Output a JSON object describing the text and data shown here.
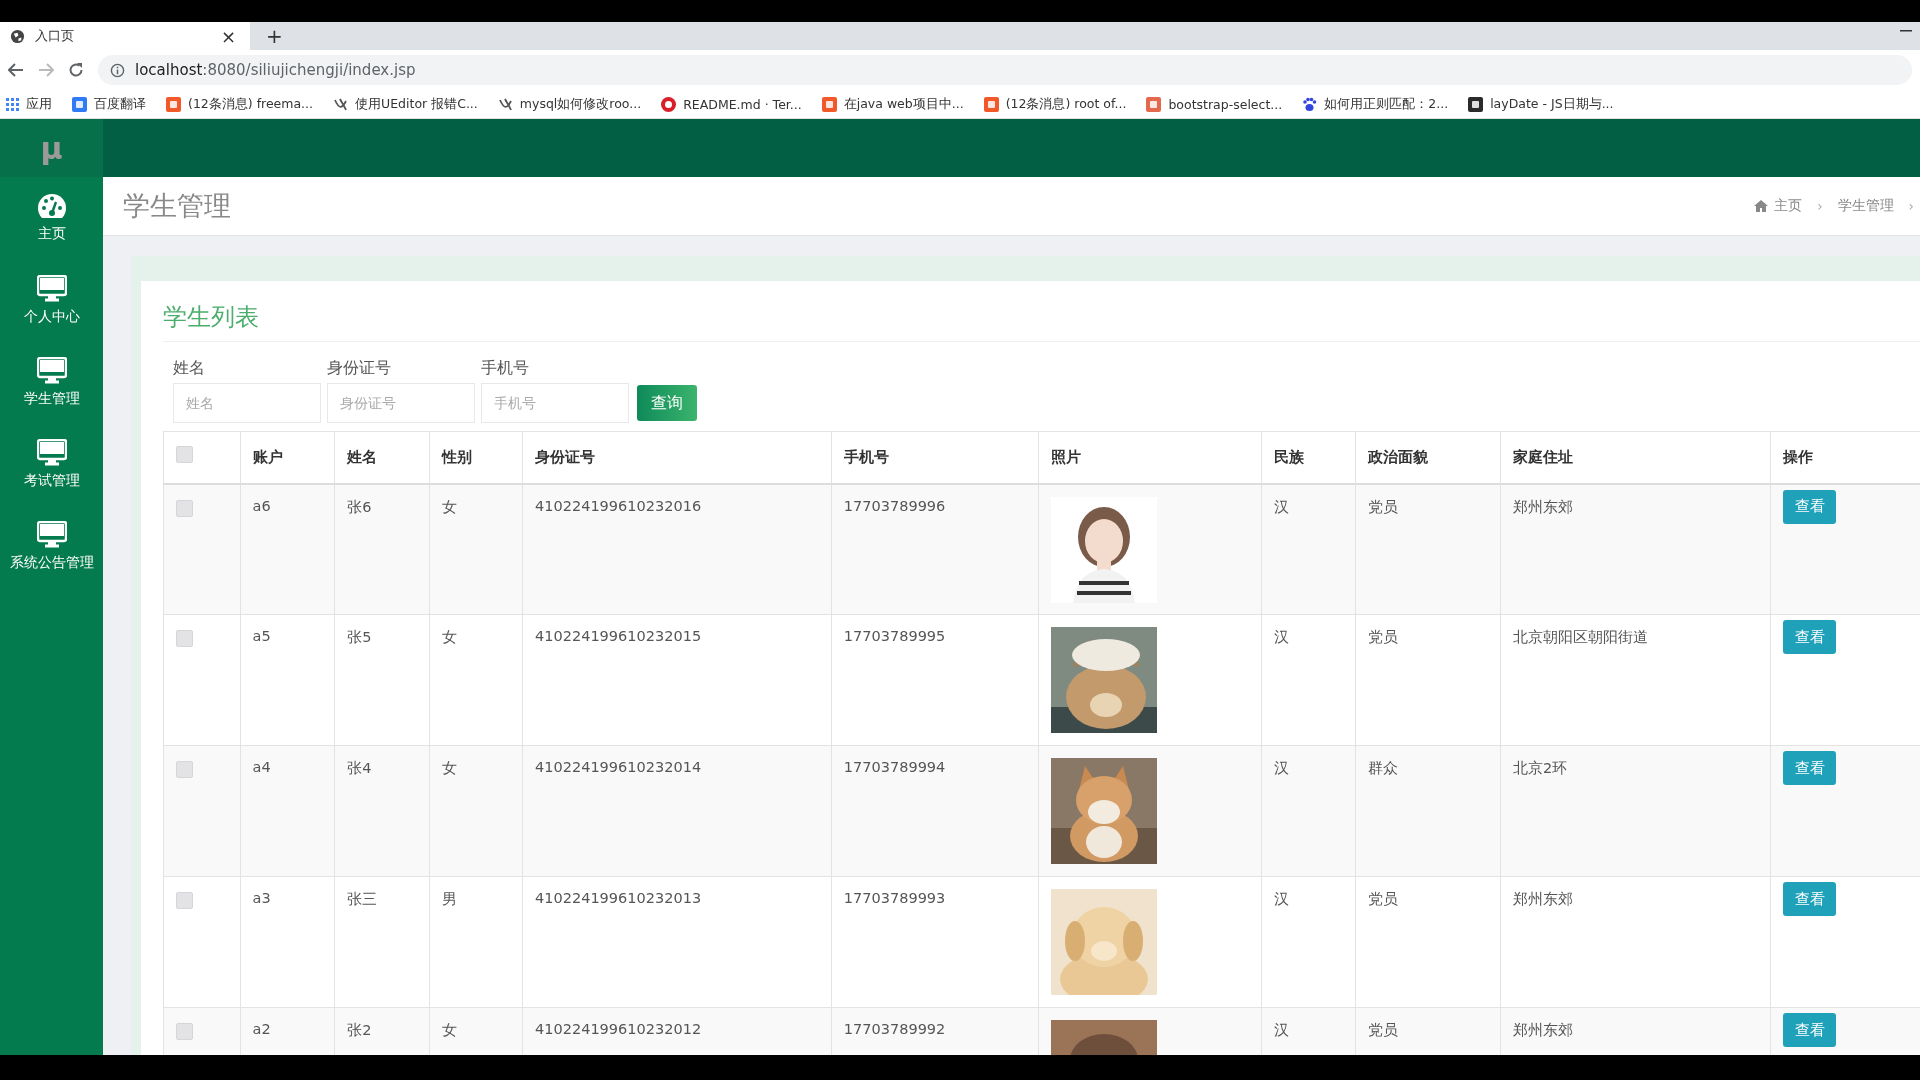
{
  "browser": {
    "tab": {
      "title": "入口页",
      "close": "×"
    },
    "new_tab": "+",
    "address": {
      "host": "localhost",
      "rest": ":8080/siliujichengji/index.jsp"
    },
    "bookmarks": [
      {
        "label": "应用",
        "kind": "apps",
        "color": "#4285f4"
      },
      {
        "label": "百度翻译",
        "kind": "tile",
        "color": "#2f7bf5"
      },
      {
        "label": "(12条消息) freema...",
        "kind": "tile",
        "color": "#f1592a"
      },
      {
        "label": "使用UEditor 报错C...",
        "kind": "swirl",
        "color": "#555555"
      },
      {
        "label": "mysql如何修改roo...",
        "kind": "swirl",
        "color": "#555555"
      },
      {
        "label": "README.md · Ter...",
        "kind": "circle",
        "color": "#d7202a"
      },
      {
        "label": "在java web项目中...",
        "kind": "tile",
        "color": "#f1592a"
      },
      {
        "label": "(12条消息) root of...",
        "kind": "tile",
        "color": "#f1592a"
      },
      {
        "label": "bootstrap-select...",
        "kind": "tile",
        "color": "#e3684e"
      },
      {
        "label": "如何用正则匹配：2...",
        "kind": "paw",
        "color": "#3245df"
      },
      {
        "label": "layDate - JS日期与...",
        "kind": "tile",
        "color": "#2b2b2b"
      }
    ]
  },
  "app": {
    "logo": "μ",
    "sidebar": [
      {
        "label": "主页",
        "kind": "gauge",
        "selected": false
      },
      {
        "label": "个人中心",
        "kind": "monitor",
        "selected": false
      },
      {
        "label": "学生管理",
        "kind": "monitor",
        "selected": false
      },
      {
        "label": "考试管理",
        "kind": "monitor",
        "selected": false
      },
      {
        "label": "系统公告管理",
        "kind": "monitor",
        "selected": false
      }
    ],
    "page_title": "学生管理",
    "breadcrumb": [
      {
        "label": "主页",
        "kind": "home"
      },
      {
        "label": "›",
        "kind": "separator"
      },
      {
        "label": "学生管理",
        "kind": "link"
      },
      {
        "label": "›",
        "kind": "separator"
      }
    ],
    "card_title": "学生列表",
    "filters": [
      {
        "label": "姓名",
        "placeholder": "姓名"
      },
      {
        "label": "身份证号",
        "placeholder": "身份证号"
      },
      {
        "label": "手机号",
        "placeholder": "手机号"
      }
    ],
    "search_button": "查询",
    "table": {
      "select_all": {
        "checked": false
      },
      "columns": [
        "账户",
        "姓名",
        "性别",
        "身份证号",
        "手机号",
        "照片",
        "民族",
        "政治面貌",
        "家庭住址",
        "操作"
      ],
      "rows": [
        {
          "checked": false,
          "account": "a6",
          "name": "张6",
          "gender": "女",
          "id_number": "410224199610232016",
          "phone": "17703789996",
          "ethnicity": "汉",
          "politics": "党员",
          "address": "郑州东郊",
          "action": "查看"
        },
        {
          "checked": false,
          "account": "a5",
          "name": "张5",
          "gender": "女",
          "id_number": "410224199610232015",
          "phone": "17703789995",
          "ethnicity": "汉",
          "politics": "党员",
          "address": "北京朝阳区朝阳街道",
          "action": "查看"
        },
        {
          "checked": false,
          "account": "a4",
          "name": "张4",
          "gender": "女",
          "id_number": "410224199610232014",
          "phone": "17703789994",
          "ethnicity": "汉",
          "politics": "群众",
          "address": "北京2环",
          "action": "查看"
        },
        {
          "checked": false,
          "account": "a3",
          "name": "张三",
          "gender": "男",
          "id_number": "410224199610232013",
          "phone": "17703789993",
          "ethnicity": "汉",
          "politics": "党员",
          "address": "郑州东郊",
          "action": "查看"
        },
        {
          "checked": false,
          "account": "a2",
          "name": "张2",
          "gender": "女",
          "id_number": "410224199610232012",
          "phone": "17703789992",
          "ethnicity": "汉",
          "politics": "党员",
          "address": "郑州东郊",
          "action": "查看"
        }
      ]
    }
  }
}
